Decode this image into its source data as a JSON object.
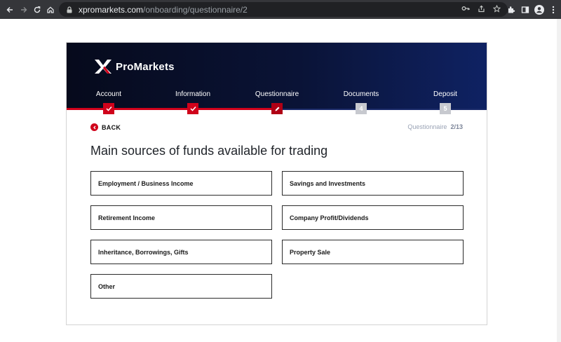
{
  "browser": {
    "url_host": "xpromarkets.com",
    "url_path": "/onboarding/questionnaire/2"
  },
  "brand": {
    "name": "ProMarkets",
    "accent": "#d0021b",
    "header_dark": "#060a1c",
    "header_light": "#0f2263"
  },
  "steps": [
    {
      "label": "Account",
      "status": "done",
      "marker": "check-icon"
    },
    {
      "label": "Information",
      "status": "done",
      "marker": "check-icon"
    },
    {
      "label": "Questionnaire",
      "status": "current",
      "marker": "pencil-icon"
    },
    {
      "label": "Documents",
      "status": "todo",
      "number": "4"
    },
    {
      "label": "Deposit",
      "status": "todo",
      "number": "5"
    }
  ],
  "back_label": "BACK",
  "counter": {
    "label": "Questionnaire",
    "value": "2/13"
  },
  "question": "Main sources of funds available for trading",
  "options": [
    "Employment / Business Income",
    "Savings and Investments",
    "Retirement Income",
    "Company Profit/Dividends",
    "Inheritance, Borrowings, Gifts",
    "Property Sale",
    "Other"
  ]
}
